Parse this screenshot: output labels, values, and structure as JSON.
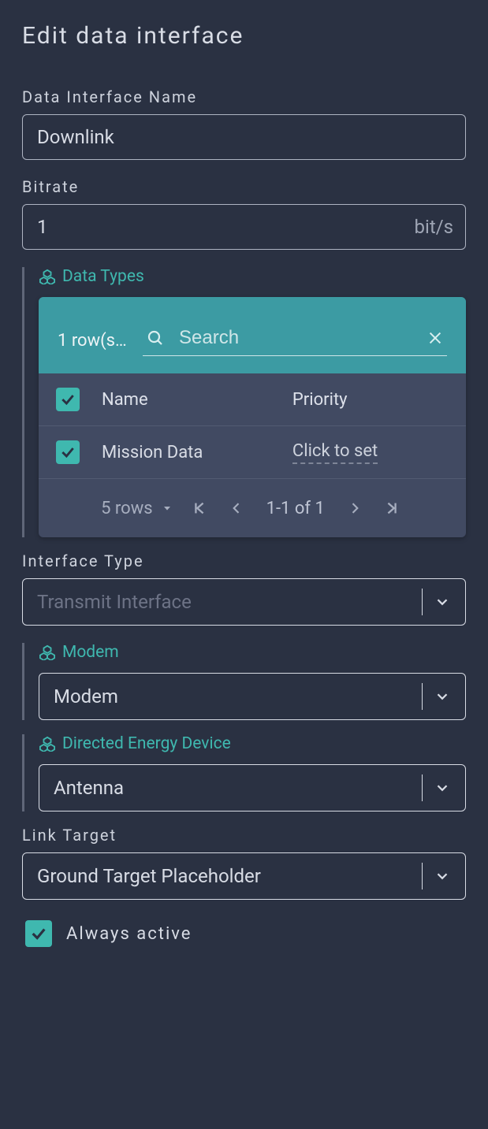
{
  "title": "Edit data interface",
  "fields": {
    "name": {
      "label": "Data Interface Name",
      "value": "Downlink"
    },
    "bitrate": {
      "label": "Bitrate",
      "value": "1",
      "unit": "bit/s"
    },
    "interface_type": {
      "label": "Interface Type",
      "value": "Transmit Interface"
    },
    "link_target": {
      "label": "Link Target",
      "value": "Ground Target Placeholder"
    }
  },
  "data_types": {
    "label": "Data Types",
    "rows_selected_text": "1 row(s) …",
    "search_placeholder": "Search",
    "columns": {
      "name": "Name",
      "priority": "Priority"
    },
    "rows": [
      {
        "name": "Mission Data",
        "priority_placeholder": "Click to set",
        "checked": true
      }
    ],
    "pager": {
      "page_size": "5 rows",
      "info": "1-1 of 1"
    }
  },
  "modem": {
    "label": "Modem",
    "value": "Modem"
  },
  "ded": {
    "label": "Directed Energy Device",
    "value": "Antenna"
  },
  "always_active": {
    "label": "Always active",
    "checked": true
  }
}
